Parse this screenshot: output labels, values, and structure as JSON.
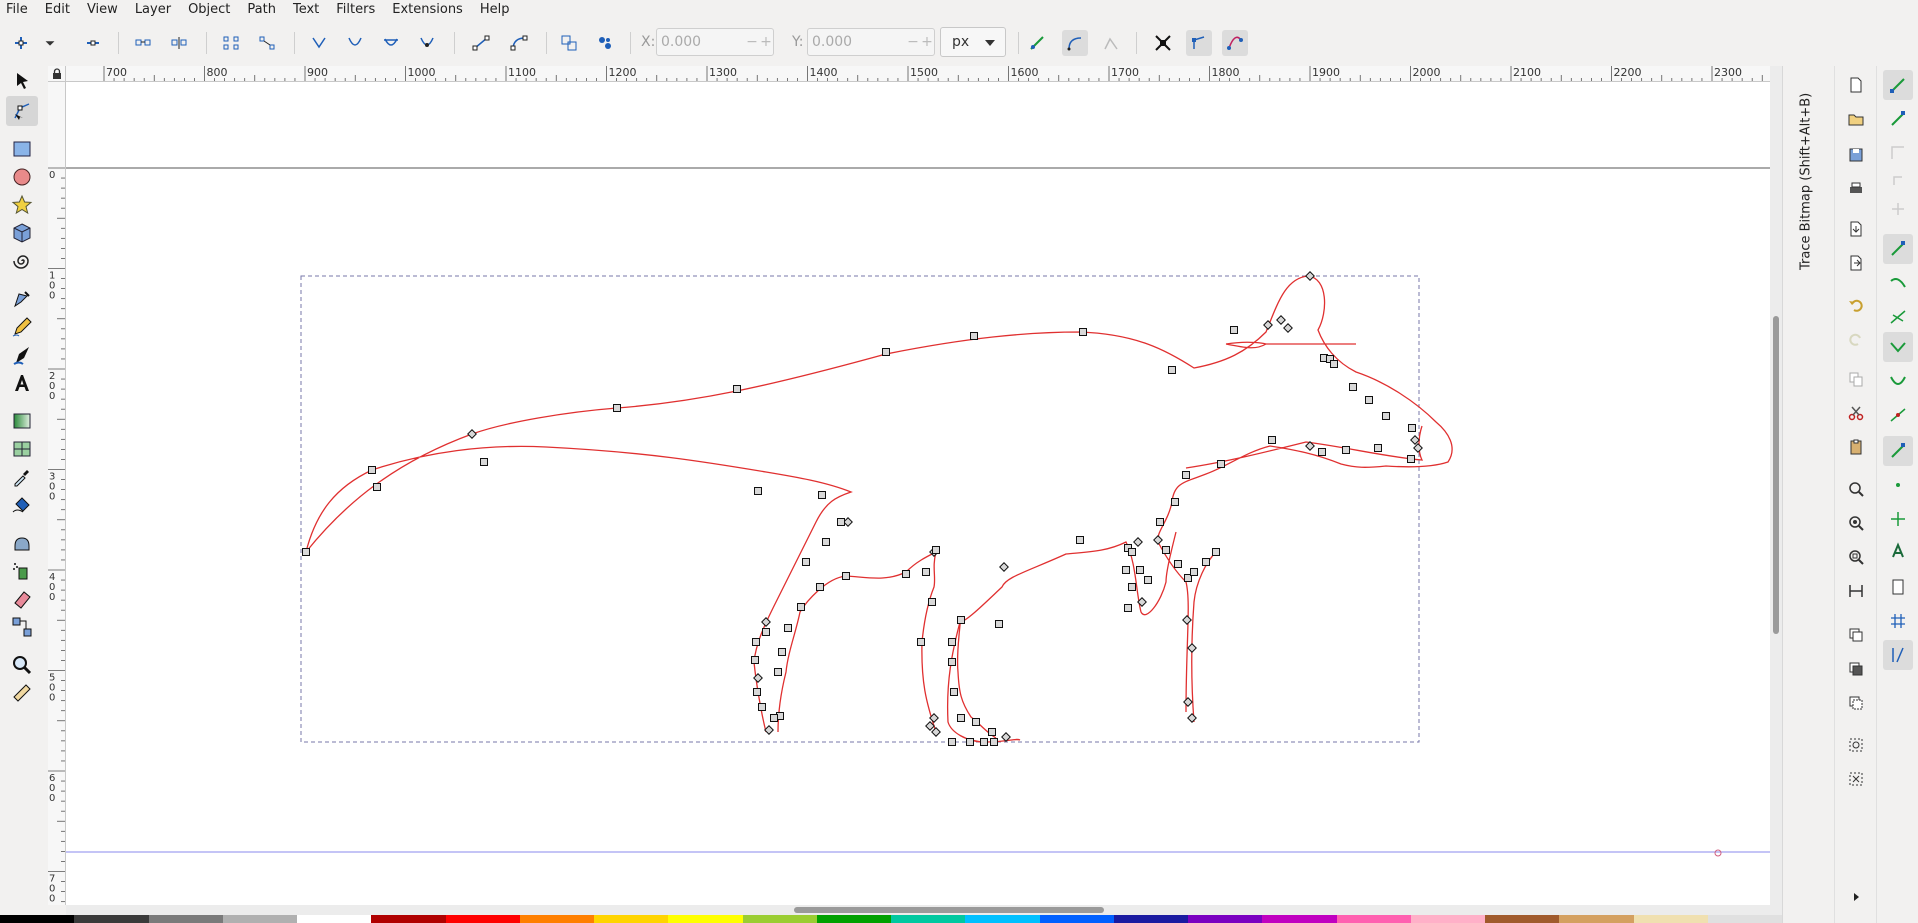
{
  "menu": [
    "File",
    "Edit",
    "View",
    "Layer",
    "Object",
    "Path",
    "Text",
    "Filters",
    "Extensions",
    "Help"
  ],
  "toolbar": {
    "x_label": "X:",
    "x_value": "0.000",
    "y_label": "Y:",
    "y_value": "0.000",
    "unit": "px",
    "pm_minus": "−",
    "pm_plus": "+"
  },
  "ruler": {
    "h_ticks": [
      "700",
      "800",
      "900",
      "1000",
      "1100",
      "1200",
      "1300",
      "1400",
      "1500",
      "1600",
      "1700",
      "1800",
      "1900",
      "2000",
      "2100",
      "2200",
      "2300"
    ],
    "v_ticks": [
      "0",
      "1\n0\n0",
      "2\n0\n0",
      "3\n0\n0",
      "4\n0\n0",
      "5\n0\n0",
      "6\n0\n0",
      "7\n0\n0"
    ]
  },
  "dock": {
    "title": "Trace Bitmap (Shift+Alt+B)"
  },
  "colors": {
    "path_stroke": "#e03030",
    "node_fill": "#d8d8d8",
    "page_border": "#555555",
    "bbox": "#7777aa",
    "guide": "#8888ee",
    "accent": "#3a6fd8"
  },
  "palette": [
    "#000000",
    "#3a3a3a",
    "#7a7a7a",
    "#b0b0b0",
    "#ffffff",
    "#b00000",
    "#ff0000",
    "#ff7f00",
    "#ffd400",
    "#ffff00",
    "#9acd32",
    "#00a000",
    "#00c8a0",
    "#00c0ff",
    "#0060ff",
    "#1a1aa0",
    "#7a00c0",
    "#c000c0",
    "#ff60b0",
    "#ffb0c8",
    "#a05a2c",
    "#d4a060",
    "#f0e0b0",
    "#e0e0e0"
  ]
}
